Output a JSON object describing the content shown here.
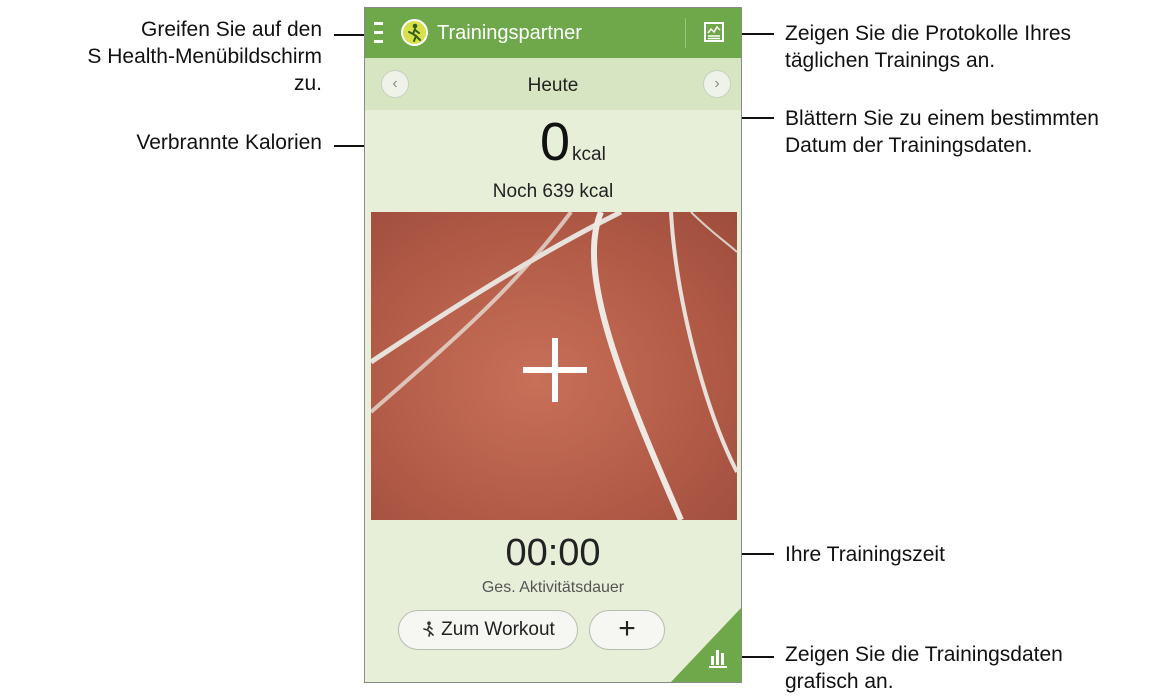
{
  "app": {
    "title": "Trainingspartner",
    "date": "Heute",
    "calories_value": "0",
    "calories_unit": "kcal",
    "calories_remaining": "Noch 639 kcal",
    "time_value": "00:00",
    "time_caption": "Ges. Aktivitätsdauer",
    "workout_button": "Zum Workout",
    "add_button": "+",
    "prev_icon": "chevron-left-icon",
    "next_icon": "chevron-right-icon",
    "colors": {
      "appbar": "#6fa84a",
      "background": "#e7efd8",
      "datebar": "#d7e6c2",
      "track": "#b35c48"
    }
  },
  "callouts": {
    "menu_line1": "Greifen Sie auf den",
    "menu_line2": "S Health-Menübildschirm zu.",
    "calories": "Verbrannte Kalorien",
    "logs_line1": "Zeigen Sie die Protokolle Ihres",
    "logs_line2": "täglichen Trainings an.",
    "date_line1": "Blättern Sie zu einem bestimmten",
    "date_line2": "Datum der Trainingsdaten.",
    "time": "Ihre Trainingszeit",
    "graph_line1": "Zeigen Sie die Trainingsdaten",
    "graph_line2": "grafisch an."
  }
}
